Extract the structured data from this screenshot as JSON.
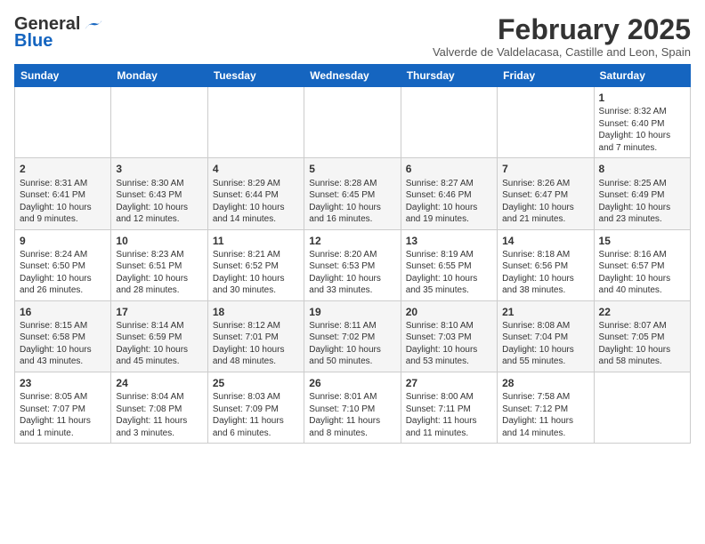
{
  "header": {
    "logo_general": "General",
    "logo_blue": "Blue",
    "month_title": "February 2025",
    "subtitle": "Valverde de Valdelacasa, Castille and Leon, Spain"
  },
  "days_of_week": [
    "Sunday",
    "Monday",
    "Tuesday",
    "Wednesday",
    "Thursday",
    "Friday",
    "Saturday"
  ],
  "weeks": [
    [
      {
        "day": "",
        "text": ""
      },
      {
        "day": "",
        "text": ""
      },
      {
        "day": "",
        "text": ""
      },
      {
        "day": "",
        "text": ""
      },
      {
        "day": "",
        "text": ""
      },
      {
        "day": "",
        "text": ""
      },
      {
        "day": "1",
        "text": "Sunrise: 8:32 AM\nSunset: 6:40 PM\nDaylight: 10 hours and 7 minutes."
      }
    ],
    [
      {
        "day": "2",
        "text": "Sunrise: 8:31 AM\nSunset: 6:41 PM\nDaylight: 10 hours and 9 minutes."
      },
      {
        "day": "3",
        "text": "Sunrise: 8:30 AM\nSunset: 6:43 PM\nDaylight: 10 hours and 12 minutes."
      },
      {
        "day": "4",
        "text": "Sunrise: 8:29 AM\nSunset: 6:44 PM\nDaylight: 10 hours and 14 minutes."
      },
      {
        "day": "5",
        "text": "Sunrise: 8:28 AM\nSunset: 6:45 PM\nDaylight: 10 hours and 16 minutes."
      },
      {
        "day": "6",
        "text": "Sunrise: 8:27 AM\nSunset: 6:46 PM\nDaylight: 10 hours and 19 minutes."
      },
      {
        "day": "7",
        "text": "Sunrise: 8:26 AM\nSunset: 6:47 PM\nDaylight: 10 hours and 21 minutes."
      },
      {
        "day": "8",
        "text": "Sunrise: 8:25 AM\nSunset: 6:49 PM\nDaylight: 10 hours and 23 minutes."
      }
    ],
    [
      {
        "day": "9",
        "text": "Sunrise: 8:24 AM\nSunset: 6:50 PM\nDaylight: 10 hours and 26 minutes."
      },
      {
        "day": "10",
        "text": "Sunrise: 8:23 AM\nSunset: 6:51 PM\nDaylight: 10 hours and 28 minutes."
      },
      {
        "day": "11",
        "text": "Sunrise: 8:21 AM\nSunset: 6:52 PM\nDaylight: 10 hours and 30 minutes."
      },
      {
        "day": "12",
        "text": "Sunrise: 8:20 AM\nSunset: 6:53 PM\nDaylight: 10 hours and 33 minutes."
      },
      {
        "day": "13",
        "text": "Sunrise: 8:19 AM\nSunset: 6:55 PM\nDaylight: 10 hours and 35 minutes."
      },
      {
        "day": "14",
        "text": "Sunrise: 8:18 AM\nSunset: 6:56 PM\nDaylight: 10 hours and 38 minutes."
      },
      {
        "day": "15",
        "text": "Sunrise: 8:16 AM\nSunset: 6:57 PM\nDaylight: 10 hours and 40 minutes."
      }
    ],
    [
      {
        "day": "16",
        "text": "Sunrise: 8:15 AM\nSunset: 6:58 PM\nDaylight: 10 hours and 43 minutes."
      },
      {
        "day": "17",
        "text": "Sunrise: 8:14 AM\nSunset: 6:59 PM\nDaylight: 10 hours and 45 minutes."
      },
      {
        "day": "18",
        "text": "Sunrise: 8:12 AM\nSunset: 7:01 PM\nDaylight: 10 hours and 48 minutes."
      },
      {
        "day": "19",
        "text": "Sunrise: 8:11 AM\nSunset: 7:02 PM\nDaylight: 10 hours and 50 minutes."
      },
      {
        "day": "20",
        "text": "Sunrise: 8:10 AM\nSunset: 7:03 PM\nDaylight: 10 hours and 53 minutes."
      },
      {
        "day": "21",
        "text": "Sunrise: 8:08 AM\nSunset: 7:04 PM\nDaylight: 10 hours and 55 minutes."
      },
      {
        "day": "22",
        "text": "Sunrise: 8:07 AM\nSunset: 7:05 PM\nDaylight: 10 hours and 58 minutes."
      }
    ],
    [
      {
        "day": "23",
        "text": "Sunrise: 8:05 AM\nSunset: 7:07 PM\nDaylight: 11 hours and 1 minute."
      },
      {
        "day": "24",
        "text": "Sunrise: 8:04 AM\nSunset: 7:08 PM\nDaylight: 11 hours and 3 minutes."
      },
      {
        "day": "25",
        "text": "Sunrise: 8:03 AM\nSunset: 7:09 PM\nDaylight: 11 hours and 6 minutes."
      },
      {
        "day": "26",
        "text": "Sunrise: 8:01 AM\nSunset: 7:10 PM\nDaylight: 11 hours and 8 minutes."
      },
      {
        "day": "27",
        "text": "Sunrise: 8:00 AM\nSunset: 7:11 PM\nDaylight: 11 hours and 11 minutes."
      },
      {
        "day": "28",
        "text": "Sunrise: 7:58 AM\nSunset: 7:12 PM\nDaylight: 11 hours and 14 minutes."
      },
      {
        "day": "",
        "text": ""
      }
    ]
  ]
}
